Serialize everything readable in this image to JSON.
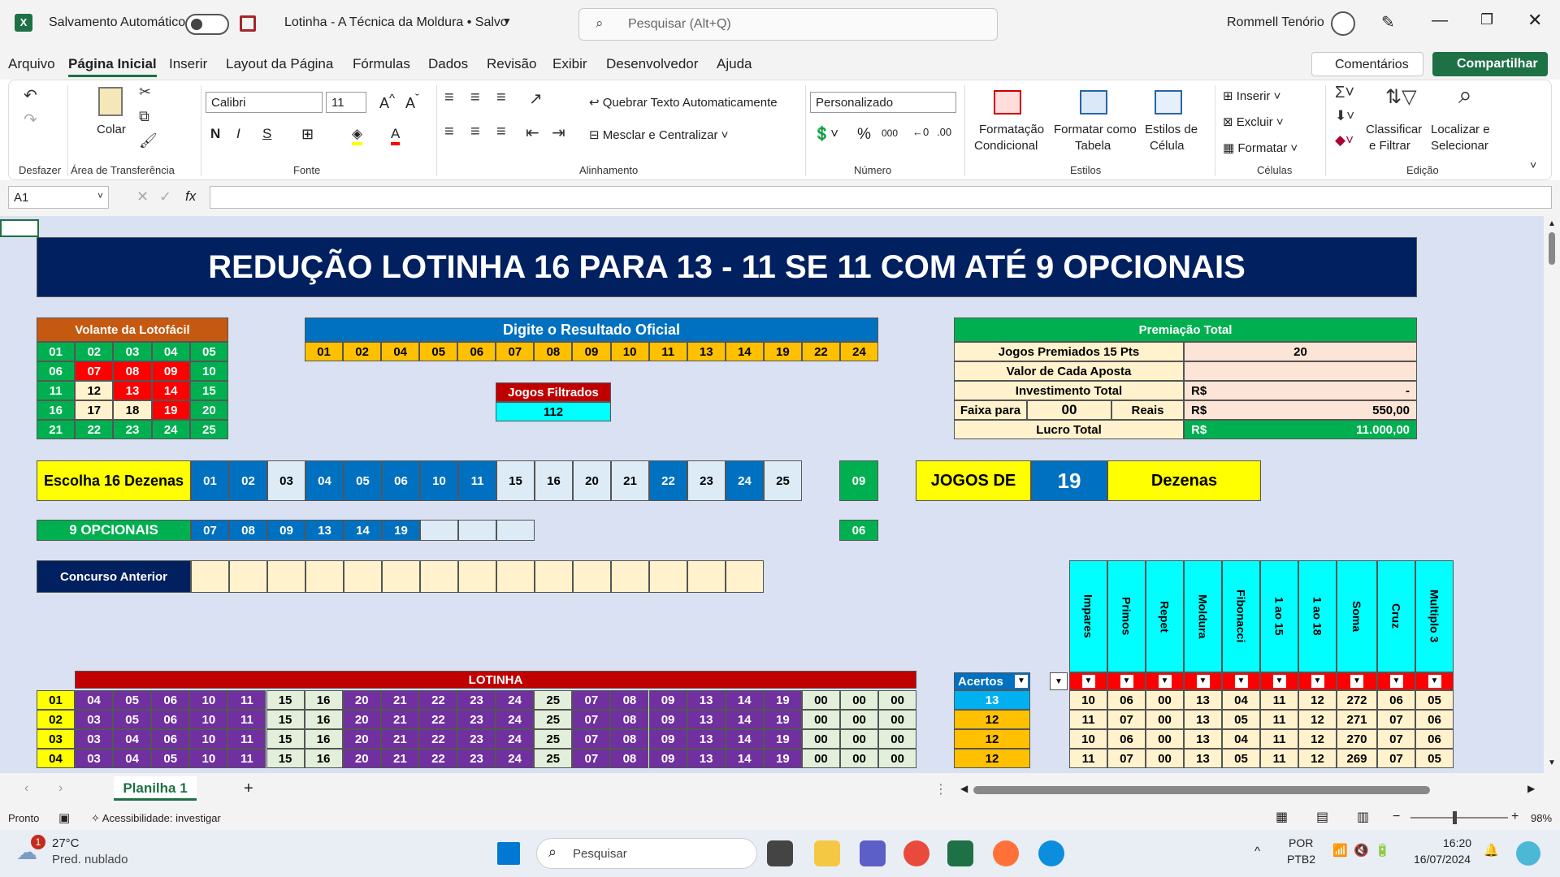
{
  "titlebar": {
    "autosave_label": "Salvamento Automático",
    "doc_title": "Lotinha - A Técnica da Moldura  •  Salvo",
    "search_placeholder": "Pesquisar (Alt+Q)",
    "user": "Rommell Tenório"
  },
  "menu": [
    "Arquivo",
    "Página Inicial",
    "Inserir",
    "Layout da Página",
    "Fórmulas",
    "Dados",
    "Revisão",
    "Exibir",
    "Desenvolvedor",
    "Ajuda"
  ],
  "menu_active": "Página Inicial",
  "comments_label": "Comentários",
  "share_label": "Compartilhar",
  "ribbon": {
    "undo_group": "Desfazer",
    "paste": "Colar",
    "clipboard_group": "Área de Transferência",
    "font_name": "Calibri",
    "font_size": "11",
    "font_group": "Fonte",
    "wrap_text": "Quebrar Texto Automaticamente",
    "merge_center": "Mesclar e Centralizar",
    "align_group": "Alinhamento",
    "number_format": "Personalizado",
    "number_group": "Número",
    "cond_format_1": "Formatação",
    "cond_format_2": "Condicional",
    "format_table_1": "Formatar como",
    "format_table_2": "Tabela",
    "cell_styles_1": "Estilos de",
    "cell_styles_2": "Célula",
    "styles_group": "Estilos",
    "insert": "Inserir",
    "delete": "Excluir",
    "format": "Formatar",
    "cells_group": "Células",
    "sort_1": "Classificar",
    "sort_2": "e Filtrar",
    "find_1": "Localizar e",
    "find_2": "Selecionar",
    "edit_group": "Edição"
  },
  "formula": {
    "namebox": "A1",
    "fx": "fx"
  },
  "sheet": {
    "main_title": "REDUÇÃO LOTINHA 16 PARA 13 - 11 SE 11 COM ATÉ 9 OPCIONAIS",
    "volante_title": "Volante da Lotofácil",
    "volante": [
      [
        {
          "v": "01",
          "c": "g"
        },
        {
          "v": "02",
          "c": "g"
        },
        {
          "v": "03",
          "c": "g"
        },
        {
          "v": "04",
          "c": "g"
        },
        {
          "v": "05",
          "c": "g"
        }
      ],
      [
        {
          "v": "06",
          "c": "g"
        },
        {
          "v": "07",
          "c": "r"
        },
        {
          "v": "08",
          "c": "r"
        },
        {
          "v": "09",
          "c": "r"
        },
        {
          "v": "10",
          "c": "g"
        }
      ],
      [
        {
          "v": "11",
          "c": "g"
        },
        {
          "v": "12",
          "c": "y"
        },
        {
          "v": "13",
          "c": "r"
        },
        {
          "v": "14",
          "c": "r"
        },
        {
          "v": "15",
          "c": "g"
        }
      ],
      [
        {
          "v": "16",
          "c": "g"
        },
        {
          "v": "17",
          "c": "y"
        },
        {
          "v": "18",
          "c": "y"
        },
        {
          "v": "19",
          "c": "r"
        },
        {
          "v": "20",
          "c": "g"
        }
      ],
      [
        {
          "v": "21",
          "c": "g"
        },
        {
          "v": "22",
          "c": "g"
        },
        {
          "v": "23",
          "c": "g"
        },
        {
          "v": "24",
          "c": "g"
        },
        {
          "v": "25",
          "c": "g"
        }
      ]
    ],
    "resultado_title": "Digite o Resultado Oficial",
    "resultado": [
      "01",
      "02",
      "04",
      "05",
      "06",
      "07",
      "08",
      "09",
      "10",
      "11",
      "13",
      "14",
      "19",
      "22",
      "24"
    ],
    "jogos_filtrados_label": "Jogos Filtrados",
    "jogos_filtrados_value": "112",
    "premiacao": {
      "title": "Premiação Total",
      "rows": [
        {
          "label": "Jogos Premiados 15 Pts",
          "value": "20"
        },
        {
          "label": "Valor de Cada Aposta",
          "value": ""
        },
        {
          "label": "Investimento Total",
          "cur": "R$",
          "value": "-"
        }
      ],
      "faixa_label": "Faixa para",
      "faixa_value": "00",
      "reais_label": "Reais",
      "faixa_cur": "R$",
      "faixa_amount": "550,00",
      "lucro_label": "Lucro Total",
      "lucro_cur": "R$",
      "lucro_value": "11.000,00"
    },
    "escolha_label": "Escolha 16 Dezenas",
    "escolha": [
      {
        "v": "01",
        "c": "b"
      },
      {
        "v": "02",
        "c": "b"
      },
      {
        "v": "03",
        "c": "w"
      },
      {
        "v": "04",
        "c": "b"
      },
      {
        "v": "05",
        "c": "b"
      },
      {
        "v": "06",
        "c": "b"
      },
      {
        "v": "10",
        "c": "b"
      },
      {
        "v": "11",
        "c": "b"
      },
      {
        "v": "15",
        "c": "w"
      },
      {
        "v": "16",
        "c": "w"
      },
      {
        "v": "20",
        "c": "w"
      },
      {
        "v": "21",
        "c": "w"
      },
      {
        "v": "22",
        "c": "b"
      },
      {
        "v": "23",
        "c": "w"
      },
      {
        "v": "24",
        "c": "b"
      },
      {
        "v": "25",
        "c": "w"
      }
    ],
    "escolha_side": "09",
    "jogos_de_label": "JOGOS DE",
    "jogos_de_value": "19",
    "dezenas_label": "Dezenas",
    "opcionais_label": "9 OPCIONAIS",
    "opcionais": [
      "07",
      "08",
      "09",
      "13",
      "14",
      "19",
      "",
      "",
      ""
    ],
    "opcionais_side": "06",
    "concurso_label": "Concurso Anterior",
    "lotinha_title": "LOTINHA",
    "acertos_label": "Acertos",
    "stat_headers": [
      "Impares",
      "Primos",
      "Repet",
      "Moldura",
      "Fibonacci",
      "1 ao 15",
      "1 ao 18",
      "Soma",
      "Cruz",
      "Multiplo 3"
    ],
    "rows": [
      {
        "id": "01",
        "nums": [
          "04",
          "05",
          "06",
          "10",
          "11",
          "15",
          "16",
          "20",
          "21",
          "22",
          "23",
          "24",
          "25",
          "07",
          "08",
          "09",
          "13",
          "14",
          "19",
          "00",
          "00",
          "00"
        ],
        "acertos": "13",
        "stats": [
          "10",
          "06",
          "00",
          "13",
          "04",
          "11",
          "12",
          "272",
          "06",
          "05"
        ]
      },
      {
        "id": "02",
        "nums": [
          "03",
          "05",
          "06",
          "10",
          "11",
          "15",
          "16",
          "20",
          "21",
          "22",
          "23",
          "24",
          "25",
          "07",
          "08",
          "09",
          "13",
          "14",
          "19",
          "00",
          "00",
          "00"
        ],
        "acertos": "12",
        "stats": [
          "11",
          "07",
          "00",
          "13",
          "05",
          "11",
          "12",
          "271",
          "07",
          "06"
        ]
      },
      {
        "id": "03",
        "nums": [
          "03",
          "04",
          "06",
          "10",
          "11",
          "15",
          "16",
          "20",
          "21",
          "22",
          "23",
          "24",
          "25",
          "07",
          "08",
          "09",
          "13",
          "14",
          "19",
          "00",
          "00",
          "00"
        ],
        "acertos": "12",
        "stats": [
          "10",
          "06",
          "00",
          "13",
          "04",
          "11",
          "12",
          "270",
          "07",
          "06"
        ]
      },
      {
        "id": "04",
        "nums": [
          "03",
          "04",
          "05",
          "10",
          "11",
          "15",
          "16",
          "20",
          "21",
          "22",
          "23",
          "24",
          "25",
          "07",
          "08",
          "09",
          "13",
          "14",
          "19",
          "00",
          "00",
          "00"
        ],
        "acertos": "12",
        "stats": [
          "11",
          "07",
          "00",
          "13",
          "05",
          "11",
          "12",
          "269",
          "07",
          "05"
        ]
      }
    ]
  },
  "tabs": {
    "sheet1": "Planilha 1",
    "add": "+"
  },
  "status": {
    "ready": "Pronto",
    "accessibility": "Acessibilidade: investigar",
    "zoom": "98%"
  },
  "taskbar": {
    "temp": "27°C",
    "weather": "Pred. nublado",
    "badge": "1",
    "search": "Pesquisar",
    "lang1": "POR",
    "lang2": "PTB2",
    "time": "16:20",
    "date": "16/07/2024"
  }
}
